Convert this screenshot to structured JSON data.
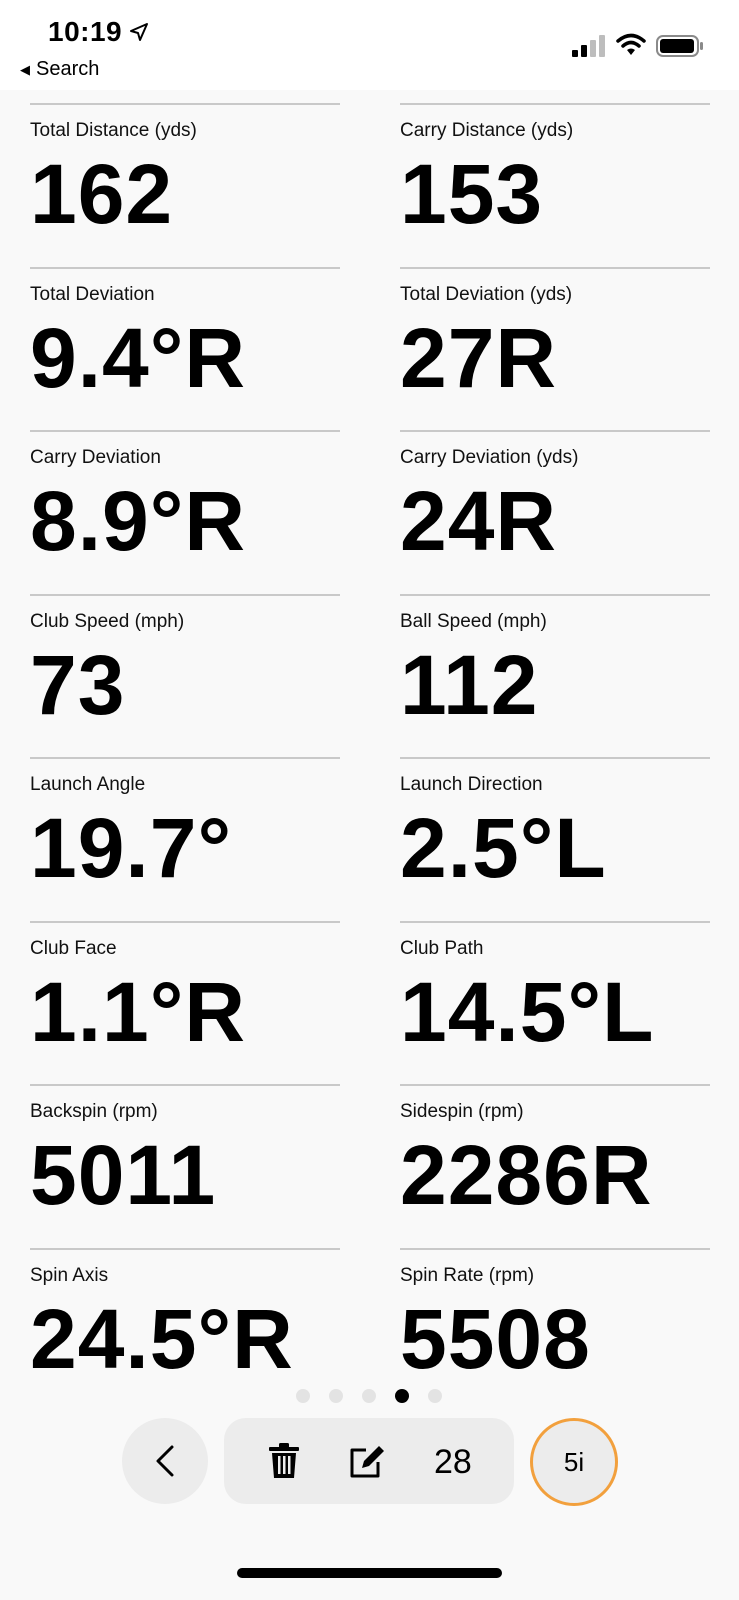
{
  "status_bar": {
    "time": "10:19",
    "back_label": "Search",
    "icons": [
      "location-arrow-icon",
      "cellular-signal-icon",
      "wifi-icon",
      "battery-icon"
    ]
  },
  "metrics": [
    [
      {
        "label": "Total Distance (yds)",
        "value": "162"
      },
      {
        "label": "Carry Distance (yds)",
        "value": "153"
      }
    ],
    [
      {
        "label": "Total Deviation",
        "value": "9.4°R"
      },
      {
        "label": "Total Deviation (yds)",
        "value": "27R"
      }
    ],
    [
      {
        "label": "Carry Deviation",
        "value": "8.9°R"
      },
      {
        "label": "Carry Deviation (yds)",
        "value": "24R"
      }
    ],
    [
      {
        "label": "Club Speed (mph)",
        "value": "73"
      },
      {
        "label": "Ball Speed (mph)",
        "value": "112"
      }
    ],
    [
      {
        "label": "Launch Angle",
        "value": "19.7°"
      },
      {
        "label": "Launch Direction",
        "value": "2.5°L"
      }
    ],
    [
      {
        "label": "Club Face",
        "value": "1.1°R"
      },
      {
        "label": "Club Path",
        "value": "14.5°L"
      }
    ],
    [
      {
        "label": "Backspin (rpm)",
        "value": "5011"
      },
      {
        "label": "Sidespin (rpm)",
        "value": "2286R"
      }
    ],
    [
      {
        "label": "Spin Axis",
        "value": "24.5°R"
      },
      {
        "label": "Spin Rate (rpm)",
        "value": "5508"
      }
    ]
  ],
  "pager": {
    "total": 5,
    "active_index": 3
  },
  "toolbar": {
    "shot_count": "28",
    "club": "5i",
    "club_ring_color": "#f2a03d",
    "icons": [
      "chevron-left-icon",
      "trash-icon",
      "edit-icon"
    ]
  }
}
